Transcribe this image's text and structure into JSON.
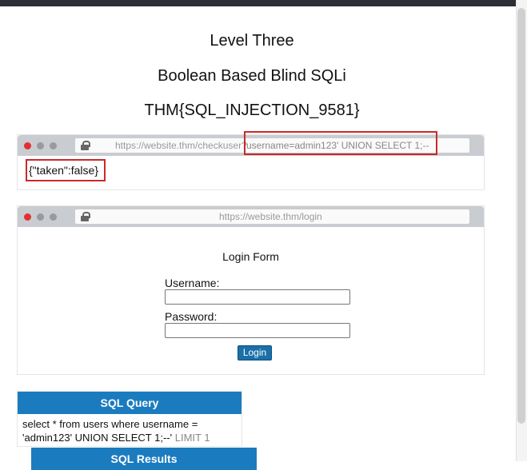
{
  "headings": {
    "level": "Level Three",
    "subtitle": "Boolean Based Blind SQLi",
    "flag": "THM{SQL_INJECTION_9581}"
  },
  "browser1": {
    "url_path": "https://website.thm/checkuser?",
    "url_query": "username=admin123' UNION SELECT 1;--",
    "response": "{\"taken\":false}"
  },
  "browser2": {
    "url": "https://website.thm/login",
    "form_title": "Login Form",
    "username_label": "Username:",
    "password_label": "Password:",
    "login_label": "Login"
  },
  "sql_query": {
    "header": "SQL Query",
    "line1": "select * from users where username =",
    "line2": "'admin123' UNION SELECT 1;--'",
    "line2_tail": " LIMIT 1"
  },
  "sql_results": {
    "header": "SQL Results"
  },
  "colors": {
    "accent": "#1b7bbf",
    "highlight": "#c92a2a",
    "button": "#1c6fa8"
  }
}
